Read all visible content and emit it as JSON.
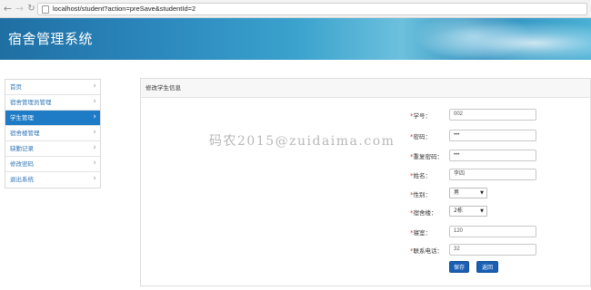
{
  "browser": {
    "url": "localhost/student?action=preSave&studentId=2"
  },
  "header": {
    "title": "宿舍管理系统"
  },
  "sidebar": {
    "items": [
      {
        "label": "首页"
      },
      {
        "label": "宿舍管理员管理"
      },
      {
        "label": "学生管理"
      },
      {
        "label": "宿舍楼管理"
      },
      {
        "label": "缺勤记录"
      },
      {
        "label": "修改密码"
      },
      {
        "label": "退出系统"
      }
    ],
    "active_index": 2
  },
  "panel": {
    "title": "修改学生信息"
  },
  "watermark": "码农2015@zuidaima.com",
  "form": {
    "required_mark": "*",
    "student_no": {
      "label": "学号：",
      "value": "002"
    },
    "password": {
      "label": "密码：",
      "value": "•••"
    },
    "password_repeat": {
      "label": "重复密码：",
      "value": "•••"
    },
    "name": {
      "label": "姓名：",
      "value": "李四"
    },
    "gender": {
      "label": "性别：",
      "value": "男"
    },
    "building": {
      "label": "宿舍楼：",
      "value": "2栋"
    },
    "room": {
      "label": "寝室：",
      "value": "120"
    },
    "phone": {
      "label": "联系电话：",
      "value": "32"
    },
    "save_label": "保存",
    "back_label": "返回"
  }
}
